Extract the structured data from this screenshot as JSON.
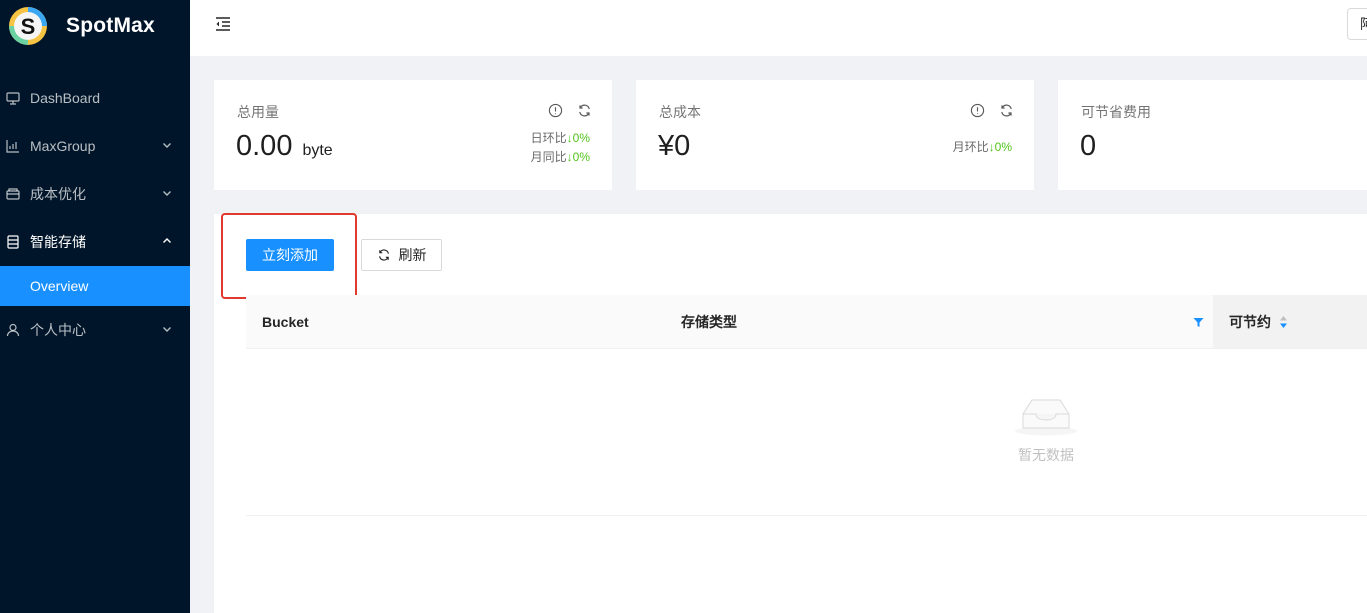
{
  "app": {
    "name": "SpotMax",
    "logo_icon": "spotmax-logo-icon"
  },
  "sidebar": {
    "items": [
      {
        "label": "DashBoard",
        "icon": "desktop-icon",
        "expandable": false
      },
      {
        "label": "MaxGroup",
        "icon": "bar-chart-icon",
        "expandable": true
      },
      {
        "label": "成本优化",
        "icon": "wallet-icon",
        "expandable": true
      },
      {
        "label": "智能存储",
        "icon": "database-icon",
        "expandable": true,
        "open": true,
        "children": [
          {
            "label": "Overview",
            "selected": true
          }
        ]
      },
      {
        "label": "个人中心",
        "icon": "user-icon",
        "expandable": true
      }
    ]
  },
  "header": {
    "right_button_label": "阿"
  },
  "stats": [
    {
      "title": "总用量",
      "value": "0.00",
      "unit": "byte",
      "trends": [
        {
          "label": "日环比",
          "pct": "0%"
        },
        {
          "label": "月同比",
          "pct": "0%"
        }
      ]
    },
    {
      "title": "总成本",
      "value": "¥0",
      "trends": [
        {
          "label": "月环比",
          "pct": "0%"
        }
      ]
    },
    {
      "title": "可节省费用",
      "value": "0"
    }
  ],
  "toolbar": {
    "add_label": "立刻添加",
    "refresh_label": "刷新"
  },
  "table": {
    "columns": [
      {
        "label": "Bucket"
      },
      {
        "label": "存储类型",
        "filter": true
      },
      {
        "label": "可节约",
        "sortable": true
      }
    ],
    "rows": [],
    "empty_text": "暂无数据"
  },
  "colors": {
    "sidebar_bg": "#001529",
    "primary": "#1890ff",
    "up_down_green": "#52c41a",
    "highlight_red": "#e0392d"
  }
}
